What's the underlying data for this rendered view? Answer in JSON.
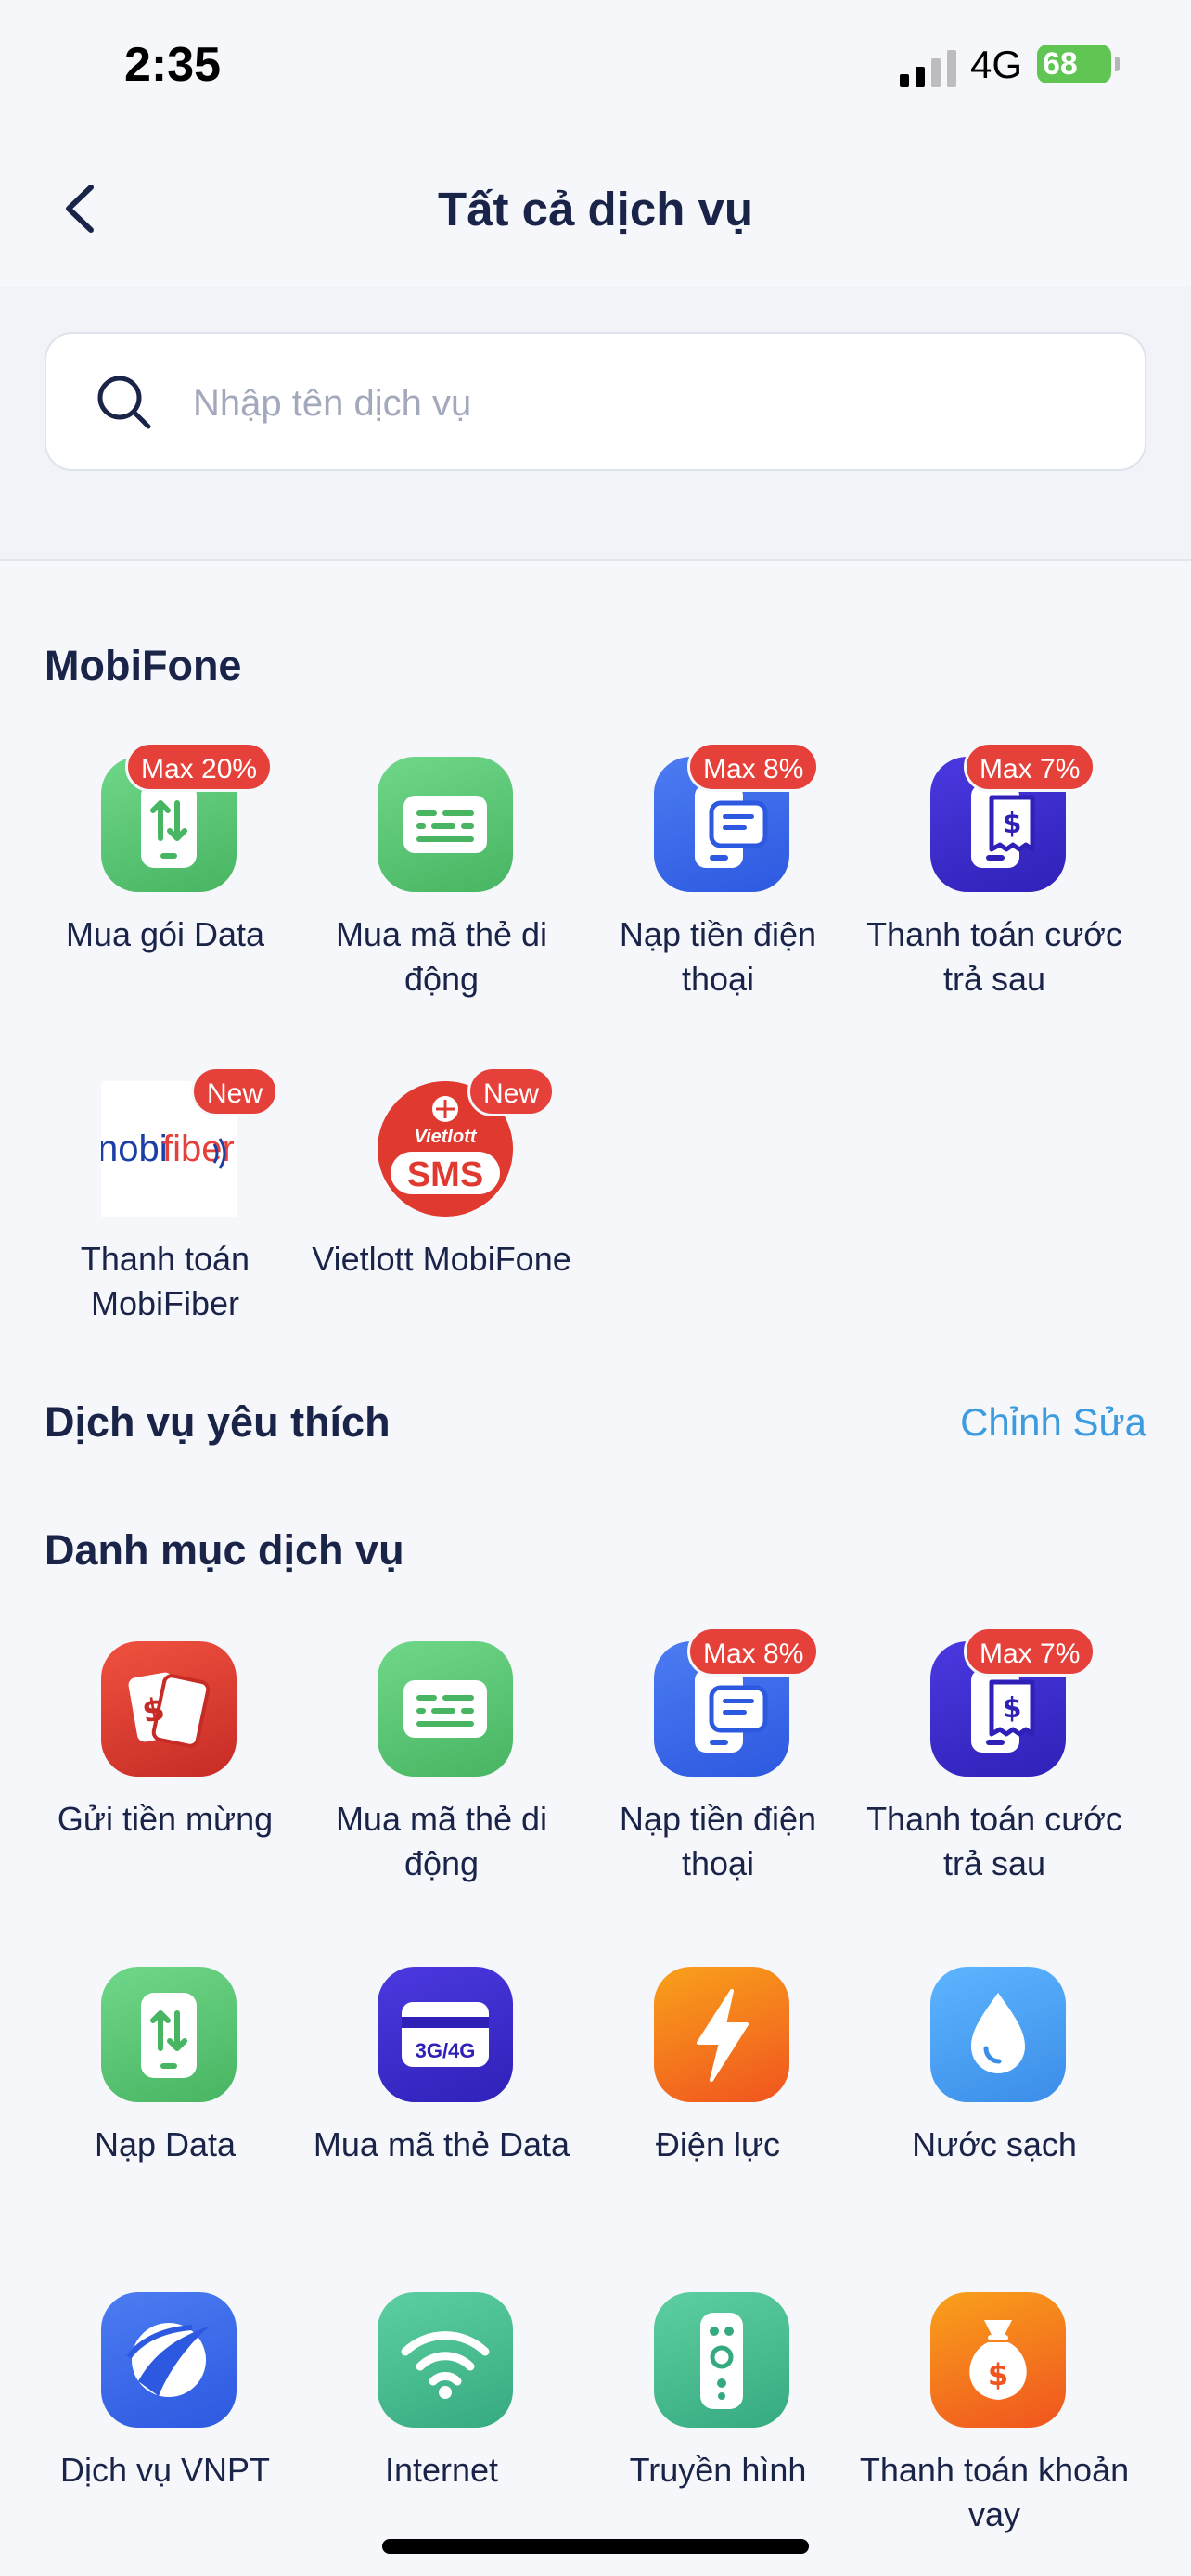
{
  "status_bar": {
    "time": "2:35",
    "network": "4G",
    "battery": "68"
  },
  "header": {
    "title": "Tất cả dịch vụ"
  },
  "search": {
    "placeholder": "Nhập tên dịch vụ"
  },
  "mobifone_section": {
    "title": "MobiFone",
    "items": [
      {
        "label": "Mua gói Data",
        "badge": "Max 20%",
        "icon": "data-transfer-icon"
      },
      {
        "label": "Mua mã thẻ di động",
        "badge": "",
        "icon": "card-icon"
      },
      {
        "label": "Nạp tiền điện thoại",
        "badge": "Max 8%",
        "icon": "phone-topup-icon"
      },
      {
        "label": "Thanh toán cước trả sau",
        "badge": "Max 7%",
        "icon": "postpaid-bill-icon"
      },
      {
        "label": "Thanh toán MobiFiber",
        "badge": "New",
        "icon": "mobifiber-logo"
      },
      {
        "label": "Vietlott MobiFone",
        "badge": "New",
        "icon": "vietlott-sms-logo",
        "logo_text": "Vietlott",
        "logo_sub": "SMS"
      }
    ]
  },
  "favorites": {
    "title": "Dịch vụ yêu thích",
    "edit_label": "Chỉnh Sửa"
  },
  "categories": {
    "title": "Danh mục dịch vụ",
    "items": [
      {
        "label": "Gửi tiền mừng",
        "badge": "",
        "icon": "gift-money-icon"
      },
      {
        "label": "Mua mã thẻ di động",
        "badge": "",
        "icon": "card-icon"
      },
      {
        "label": "Nạp tiền điện thoại",
        "badge": "Max 8%",
        "icon": "phone-topup-icon"
      },
      {
        "label": "Thanh toán cước trả sau",
        "badge": "Max 7%",
        "icon": "postpaid-bill-icon"
      },
      {
        "label": "Nạp Data",
        "badge": "",
        "icon": "data-transfer-icon"
      },
      {
        "label": "Mua mã thẻ Data",
        "badge": "",
        "icon": "data-card-icon",
        "icon_text": "3G/4G"
      },
      {
        "label": "Điện lực",
        "badge": "",
        "icon": "lightning-icon"
      },
      {
        "label": "Nước sạch",
        "badge": "",
        "icon": "water-drop-icon"
      },
      {
        "label": "Dịch vụ VNPT",
        "badge": "",
        "icon": "vnpt-logo"
      },
      {
        "label": "Internet",
        "badge": "",
        "icon": "wifi-icon"
      },
      {
        "label": "Truyền hình",
        "badge": "",
        "icon": "remote-control-icon"
      },
      {
        "label": "Thanh toán khoản vay",
        "badge": "",
        "icon": "money-bag-icon"
      }
    ]
  }
}
